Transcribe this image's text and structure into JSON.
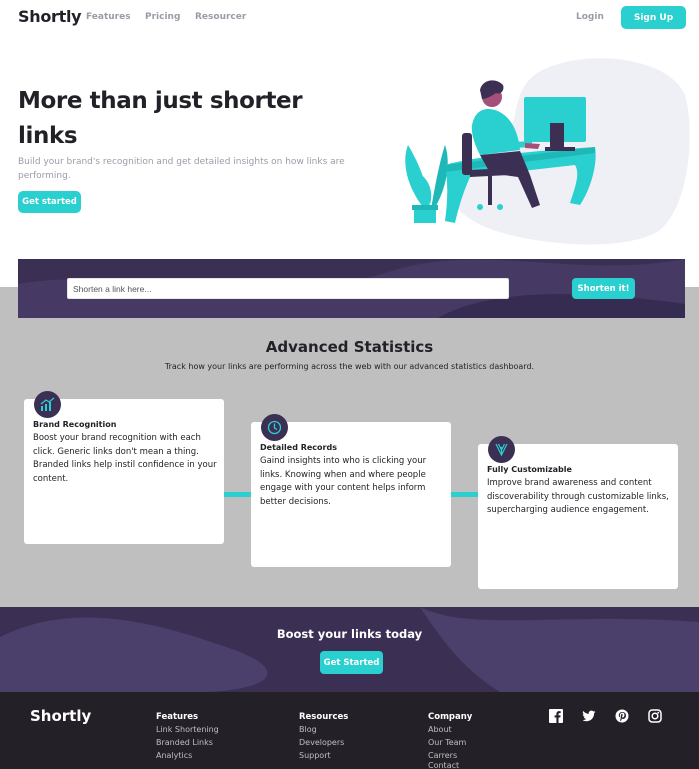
{
  "nav": {
    "logo": "Shortly",
    "links": [
      "Features",
      "Pricing",
      "Resourcer"
    ],
    "login": "Login",
    "signup": "Sign Up"
  },
  "hero": {
    "title": "More than just shorter links",
    "description": "Build your brand's recognition and get detailed insights on how links are performing.",
    "cta": "Get started"
  },
  "shorten": {
    "placeholder": "Shorten a link here...",
    "button": "Shorten it!"
  },
  "stats": {
    "title": "Advanced Statistics",
    "subtitle": "Track how your links are performing across the web with our advanced statistics dashboard.",
    "cards": [
      {
        "icon": "chart-icon",
        "title": "Brand Recognition",
        "text": "Boost your brand recognition with each click. Generic links don't mean a thing. Branded links help instil confidence in your content."
      },
      {
        "icon": "gauge-icon",
        "title": "Detailed Records",
        "text": "Gaind insights into who is clicking your links. Knowing when and where people engage with your content helps inform better decisions."
      },
      {
        "icon": "pens-icon",
        "title": "Fully Customizable",
        "text": "Improve brand awareness and content discoverability through customizable links, supercharging audience engagement."
      }
    ]
  },
  "boost": {
    "title": "Boost your links today",
    "cta": "Get Started"
  },
  "footer": {
    "logo": "Shortly",
    "columns": [
      {
        "heading": "Features",
        "links": [
          "Link Shortening",
          "Branded Links",
          "Analytics"
        ]
      },
      {
        "heading": "Resources",
        "links": [
          "Blog",
          "Developers",
          "Support"
        ]
      },
      {
        "heading": "Company",
        "links": [
          "About",
          "Our Team",
          "Carrers",
          "Contact"
        ]
      }
    ],
    "social": [
      "facebook-icon",
      "twitter-icon",
      "pinterest-icon",
      "instagram-icon"
    ]
  },
  "colors": {
    "cyan": "#2acfcf",
    "dark_violet": "#3b3054",
    "very_dark_violet": "#232127",
    "gray": "#9e9aa7",
    "band_gray": "#bfbfbf"
  }
}
